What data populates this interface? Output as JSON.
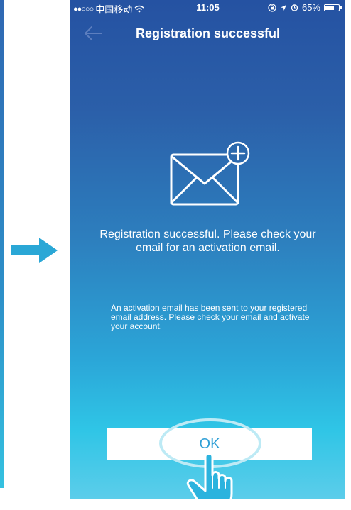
{
  "status_bar": {
    "carrier": "中国移动",
    "time": "11:05",
    "battery_percent": "65%",
    "battery_level": 0.65,
    "icons": [
      "signal-dots",
      "wifi-icon",
      "alarm-icon",
      "location-arrow-icon",
      "orientation-lock-icon",
      "battery-icon"
    ]
  },
  "nav": {
    "title": "Registration successful",
    "back_icon": "back-arrow-icon"
  },
  "content": {
    "icon": "email-add-icon",
    "headline": "Registration successful. Please check your email for an activation email.",
    "body": "An activation email has been sent to your registered email address. Please check your email and activate your account."
  },
  "actions": {
    "ok_label": "OK"
  },
  "annotations": {
    "pointer_arrow_icon": "right-arrow-icon",
    "tap_hand_icon": "tap-hand-icon"
  },
  "colors": {
    "gradient_top": "#2552a2",
    "gradient_bottom": "#5ccdea",
    "ok_text": "#2f9fd6",
    "arrow": "#2aa7d6"
  }
}
